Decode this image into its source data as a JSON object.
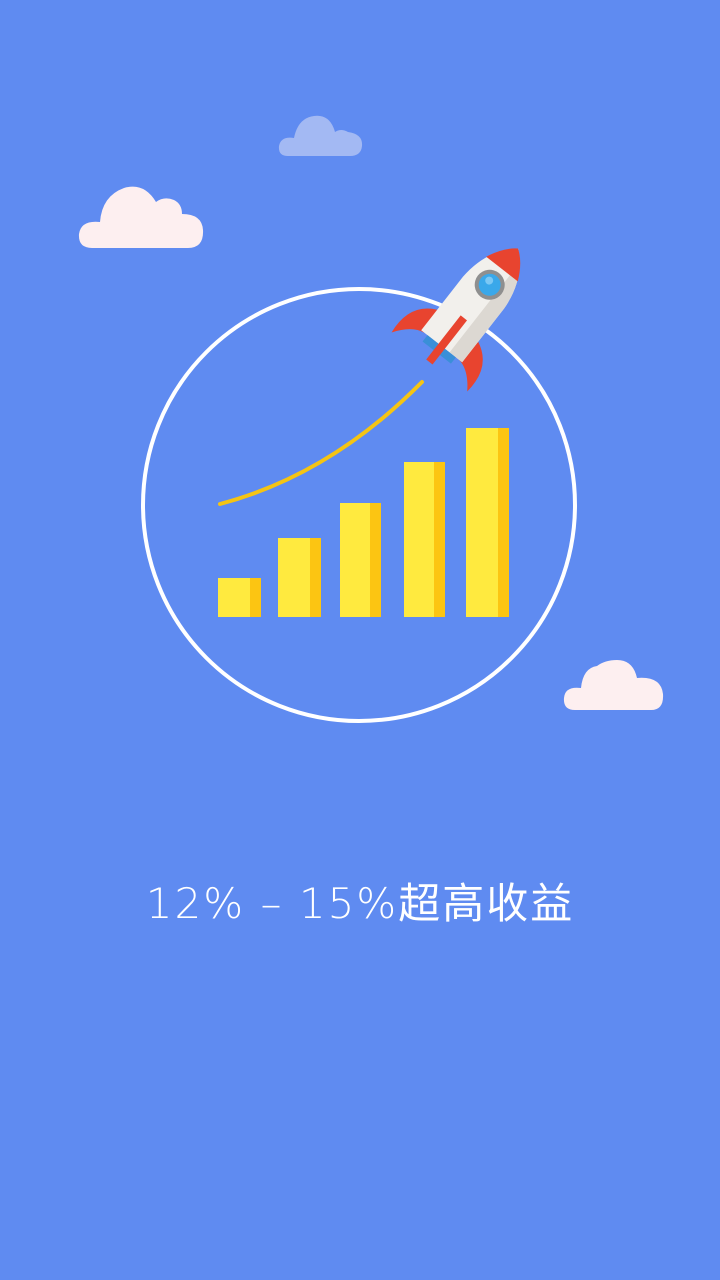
{
  "colors": {
    "background": "#5f8bf1",
    "cloud_pink": "#fdeff0",
    "cloud_faded": "#a3b9f3",
    "bar_light": "#ffea3f",
    "bar_dark": "#fcc512",
    "trend_line": "#f5c413",
    "circle": "#ffffff",
    "rocket_body": "#f2f0ec",
    "rocket_red": "#e8442f",
    "rocket_window": "#3aa8ea"
  },
  "illustration": {
    "bars_relative_heights": [
      0.2,
      0.41,
      0.6,
      0.81,
      1.0
    ],
    "icons": [
      "cloud-icon",
      "rocket-icon",
      "growth-bar-chart-icon",
      "trend-line-icon"
    ]
  },
  "tagline": "12% – 15%超高收益"
}
